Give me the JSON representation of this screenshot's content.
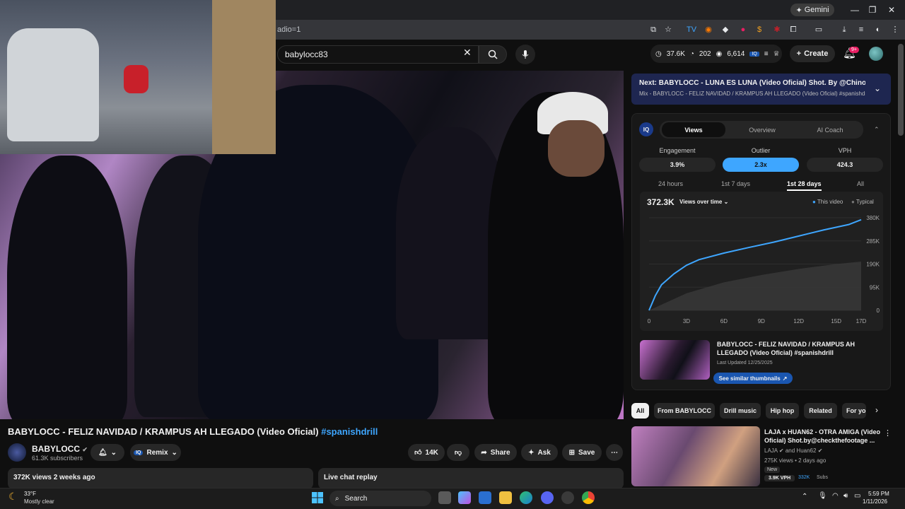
{
  "browser": {
    "gemini_label": "Gemini",
    "url_fragment": "adio=1"
  },
  "header": {
    "search_value": "babylocc83",
    "stats": {
      "views": "37.6K",
      "subs": "202",
      "videos": "6,614"
    },
    "create_label": "Create",
    "notif_count": "9+"
  },
  "video": {
    "title": "BABYLOCC - FELIZ NAVIDAD / KRAMPUS AH LLEGADO (Video Oficial) ",
    "hashtag": "#spanishdrill",
    "channel": "BABYLOCC",
    "subs": "61.3K subscribers",
    "remix_label": "Remix",
    "likes": "14K",
    "share_label": "Share",
    "ask_label": "Ask",
    "save_label": "Save",
    "desc_views": "372K views  2 weeks ago",
    "live_chat": "Live chat replay"
  },
  "sidebar": {
    "next_title": "Next: BABYLOCC - LUNA ES LUNA (Video Oficial) Shot. By @ChinolaFilms #...",
    "next_sub": "Mix - BABYLOCC - FELIZ NAVIDAD / KRAMPUS AH LLEGADO (Video Oficial) #spanishdrill",
    "iq": {
      "logo": "IQ",
      "tabs": [
        "Views",
        "Overview",
        "AI Coach"
      ],
      "metrics": [
        {
          "label": "Engagement",
          "value": "3.9%"
        },
        {
          "label": "Outlier",
          "value": "2.3x",
          "accent": "#3ea6ff"
        },
        {
          "label": "VPH",
          "value": "424.3"
        }
      ],
      "ranges": [
        "24 hours",
        "1st 7 days",
        "1st 28 days",
        "All"
      ],
      "total": "372.3K",
      "mode": "Views over time",
      "legend": [
        "This video",
        "Typical"
      ],
      "card_title": "BABYLOCC - FELIZ NAVIDAD / KRAMPUS AH LLEGADO (Video Oficial) #spanishdrill",
      "card_date": "Last Updated 12/25/2025",
      "similar_label": "See similar thumbnails"
    },
    "chips": [
      "All",
      "From BABYLOCC",
      "Drill music",
      "Hip hop",
      "Related",
      "For yo"
    ],
    "rec": {
      "title": "LAJA x HUAN62 - OTRA AMIGA (Video Oficial) Shot.by@checkthefootage ...",
      "channel": "LAJA",
      "channel2": "and Huan62",
      "meta": "275K views • 2 days ago",
      "badge": "New",
      "vph": "3.9K VPH",
      "subs": "332K",
      "subs_label": "Subs"
    }
  },
  "chart_data": {
    "type": "area",
    "title": "",
    "x": [
      "0",
      "3D",
      "6D",
      "9D",
      "12D",
      "15D",
      "17D"
    ],
    "x_values": [
      0,
      3,
      6,
      9,
      12,
      15,
      17
    ],
    "ylim": [
      0,
      380000
    ],
    "y_ticks": [
      "0",
      "95K",
      "190K",
      "285K",
      "380K"
    ],
    "series": [
      {
        "name": "This video",
        "x": [
          0,
          0.5,
          1,
          2,
          3,
          4,
          6,
          8,
          10,
          12,
          14,
          16,
          17
        ],
        "values": [
          0,
          60000,
          105000,
          150000,
          185000,
          208000,
          235000,
          258000,
          280000,
          305000,
          330000,
          352000,
          372000
        ],
        "color": "#3ea6ff"
      },
      {
        "name": "Typical",
        "x": [
          0,
          3,
          6,
          9,
          12,
          15,
          17
        ],
        "values": [
          0,
          70000,
          115000,
          145000,
          170000,
          190000,
          200000
        ],
        "color": "#4a4a4a"
      }
    ],
    "grid": true,
    "legend": "top-right"
  },
  "taskbar": {
    "temp": "33°F",
    "weather": "Mostly clear",
    "search": "Search",
    "time": "5:59 PM",
    "date": "1/11/2026"
  }
}
